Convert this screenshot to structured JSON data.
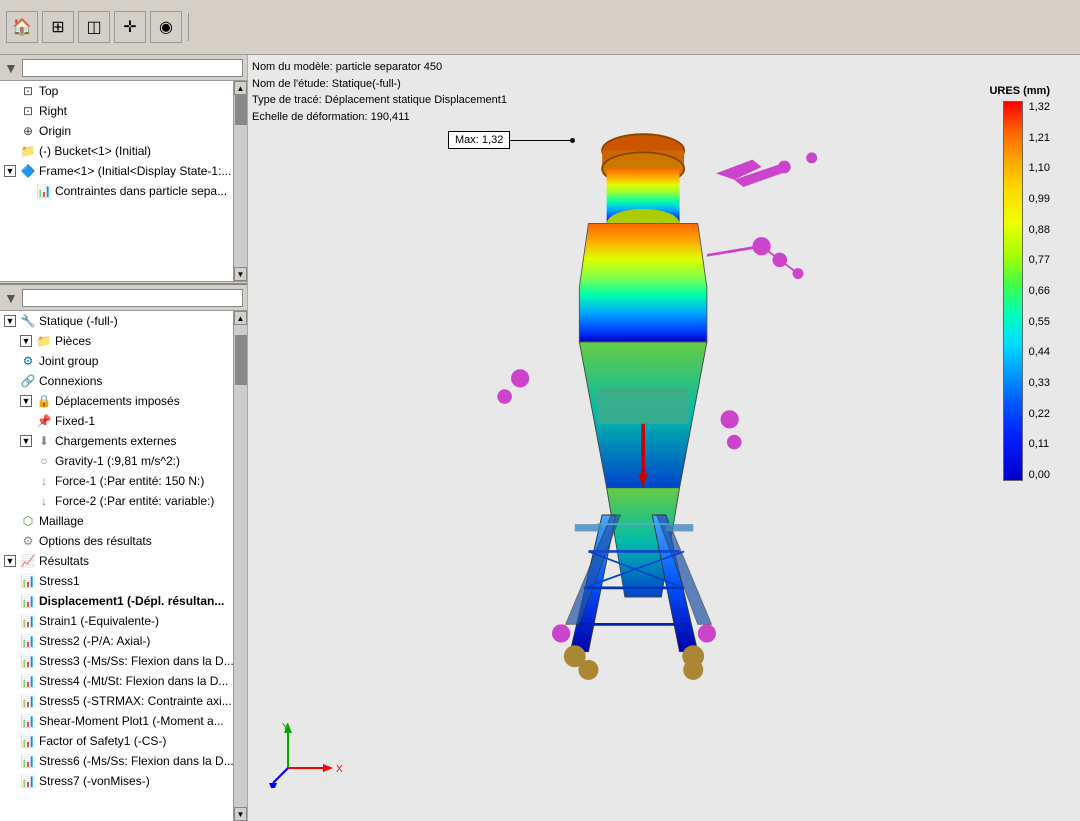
{
  "toolbar": {
    "icons": [
      "🏠",
      "⊞",
      "◫",
      "✛",
      "◉"
    ],
    "tooltips": [
      "Home",
      "Grid",
      "Panels",
      "Add",
      "Settings"
    ]
  },
  "viewport_info": {
    "line1": "Nom du modèle: particle separator 450",
    "line2": "Nom de l'étude: Statique(-full-)",
    "line3": "Type de tracé: Déplacement statique Displacement1",
    "line4": "Echelle de déformation: 190,411"
  },
  "max_callout": {
    "label": "Max:",
    "value": "1,32"
  },
  "legend": {
    "title": "URES (mm)",
    "values": [
      "1,32",
      "1,21",
      "1,10",
      "0,99",
      "0,88",
      "0,77",
      "0,66",
      "0,55",
      "0,44",
      "0,33",
      "0,22",
      "0,11",
      "0,00"
    ]
  },
  "tree_top": {
    "filter_placeholder": "",
    "items": [
      {
        "label": "Top",
        "indent": 1,
        "icon": "plane",
        "expand": false
      },
      {
        "label": "Right",
        "indent": 1,
        "icon": "plane",
        "expand": false
      },
      {
        "label": "Origin",
        "indent": 1,
        "icon": "origin",
        "expand": false
      },
      {
        "label": "(-) Bucket<1> (Initial)",
        "indent": 1,
        "icon": "folder",
        "expand": false
      },
      {
        "label": "Frame<1> (Initial<Display State-1:...",
        "indent": 0,
        "icon": "sim",
        "expand": true
      },
      {
        "label": "Contraintes dans particle sepa...",
        "indent": 2,
        "icon": "feature",
        "expand": false
      }
    ]
  },
  "tree_bottom": {
    "filter_placeholder": "",
    "items": [
      {
        "label": "Statique (-full-)",
        "indent": 0,
        "icon": "sim",
        "expand": true,
        "bold": false
      },
      {
        "label": "Pièces",
        "indent": 1,
        "icon": "folder",
        "expand": true,
        "bold": false
      },
      {
        "label": "Joint group",
        "indent": 1,
        "icon": "gear",
        "expand": false,
        "bold": false
      },
      {
        "label": "Connexions",
        "indent": 1,
        "icon": "conn",
        "expand": false,
        "bold": false
      },
      {
        "label": "Déplacements imposés",
        "indent": 1,
        "icon": "disp",
        "expand": true,
        "bold": false
      },
      {
        "label": "Fixed-1",
        "indent": 2,
        "icon": "fixed",
        "expand": false,
        "bold": false
      },
      {
        "label": "Chargements externes",
        "indent": 1,
        "icon": "load",
        "expand": true,
        "bold": false
      },
      {
        "label": "Gravity-1 (:9,81 m/s^2:)",
        "indent": 2,
        "icon": "gravity",
        "expand": false,
        "bold": false
      },
      {
        "label": "Force-1 (:Par entité: 150 N:)",
        "indent": 2,
        "icon": "force",
        "expand": false,
        "bold": false
      },
      {
        "label": "Force-2 (:Par entité: variable:)",
        "indent": 2,
        "icon": "force",
        "expand": false,
        "bold": false
      },
      {
        "label": "Maillage",
        "indent": 1,
        "icon": "mesh",
        "expand": false,
        "bold": false
      },
      {
        "label": "Options des résultats",
        "indent": 1,
        "icon": "options",
        "expand": false,
        "bold": false
      },
      {
        "label": "Résultats",
        "indent": 0,
        "icon": "results",
        "expand": true,
        "bold": false
      },
      {
        "label": "Stress1",
        "indent": 1,
        "icon": "result",
        "expand": false,
        "bold": false
      },
      {
        "label": "Displacement1 (-Dépl. résultan...",
        "indent": 1,
        "icon": "result",
        "expand": false,
        "bold": true
      },
      {
        "label": "Strain1 (-Equivalente-)",
        "indent": 1,
        "icon": "result",
        "expand": false,
        "bold": false
      },
      {
        "label": "Stress2 (-P/A: Axial-)",
        "indent": 1,
        "icon": "result",
        "expand": false,
        "bold": false
      },
      {
        "label": "Stress3 (-Ms/Ss: Flexion dans la D...",
        "indent": 1,
        "icon": "result",
        "expand": false,
        "bold": false
      },
      {
        "label": "Stress4 (-Mt/St: Flexion dans la D...",
        "indent": 1,
        "icon": "result",
        "expand": false,
        "bold": false
      },
      {
        "label": "Stress5 (-STRMAX: Contrainte axi...",
        "indent": 1,
        "icon": "result",
        "expand": false,
        "bold": false
      },
      {
        "label": "Shear-Moment Plot1 (-Moment a...",
        "indent": 1,
        "icon": "result",
        "expand": false,
        "bold": false
      },
      {
        "label": "Factor of Safety1 (-CS-)",
        "indent": 1,
        "icon": "result",
        "expand": false,
        "bold": false
      },
      {
        "label": "Stress6 (-Ms/Ss: Flexion dans la D...",
        "indent": 1,
        "icon": "result",
        "expand": false,
        "bold": false
      },
      {
        "label": "Stress7 (-vonMises-)",
        "indent": 1,
        "icon": "result",
        "expand": false,
        "bold": false
      }
    ]
  }
}
